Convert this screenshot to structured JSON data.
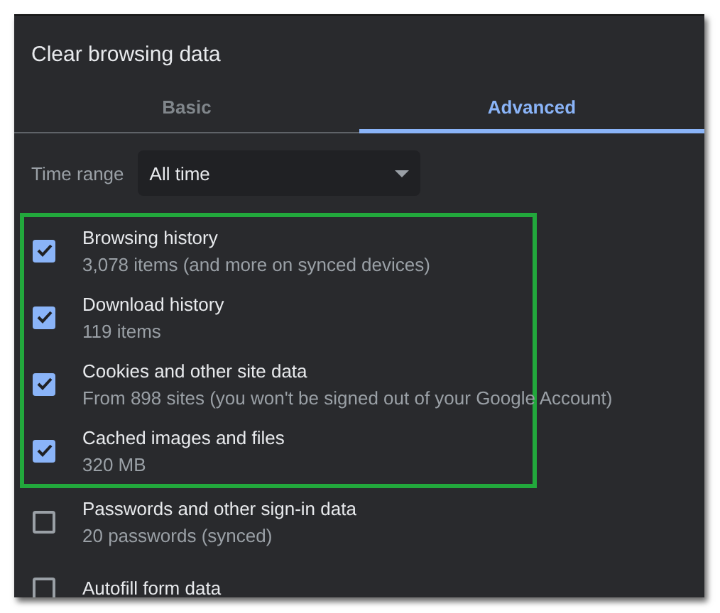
{
  "dialog": {
    "title": "Clear browsing data"
  },
  "tabs": [
    {
      "label": "Basic",
      "selected": false
    },
    {
      "label": "Advanced",
      "selected": true
    }
  ],
  "time_range": {
    "label": "Time range",
    "value": "All time"
  },
  "items": [
    {
      "title": "Browsing history",
      "detail": "3,078 items (and more on synced devices)",
      "checked": true,
      "highlighted": true
    },
    {
      "title": "Download history",
      "detail": "119 items",
      "checked": true,
      "highlighted": true
    },
    {
      "title": "Cookies and other site data",
      "detail": "From 898 sites (you won't be signed out of your Google Account)",
      "checked": true,
      "highlighted": true
    },
    {
      "title": "Cached images and files",
      "detail": "320 MB",
      "checked": true,
      "highlighted": true
    },
    {
      "title": "Passwords and other sign-in data",
      "detail": "20 passwords (synced)",
      "checked": false,
      "highlighted": false
    },
    {
      "title": "Autofill form data",
      "checked": false,
      "highlighted": false
    }
  ]
}
